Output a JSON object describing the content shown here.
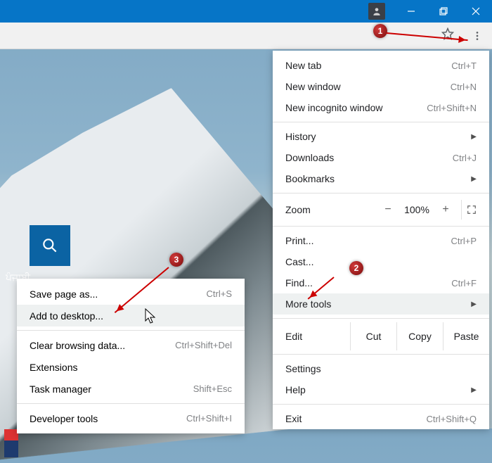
{
  "titlebar": {
    "profile_icon": "person"
  },
  "menu": {
    "new_tab": "New tab",
    "new_tab_sc": "Ctrl+T",
    "new_window": "New window",
    "new_window_sc": "Ctrl+N",
    "new_incognito": "New incognito window",
    "new_incognito_sc": "Ctrl+Shift+N",
    "history": "History",
    "downloads": "Downloads",
    "downloads_sc": "Ctrl+J",
    "bookmarks": "Bookmarks",
    "zoom_label": "Zoom",
    "zoom_value": "100%",
    "print": "Print...",
    "print_sc": "Ctrl+P",
    "cast": "Cast...",
    "find": "Find...",
    "find_sc": "Ctrl+F",
    "more_tools": "More tools",
    "edit": "Edit",
    "cut": "Cut",
    "copy": "Copy",
    "paste": "Paste",
    "settings": "Settings",
    "help": "Help",
    "exit": "Exit",
    "exit_sc": "Ctrl+Shift+Q"
  },
  "submenu": {
    "save_page": "Save page as...",
    "save_page_sc": "Ctrl+S",
    "add_desktop": "Add to desktop...",
    "clear_data": "Clear browsing data...",
    "clear_data_sc": "Ctrl+Shift+Del",
    "extensions": "Extensions",
    "task_manager": "Task manager",
    "task_manager_sc": "Shift+Esc",
    "dev_tools": "Developer tools",
    "dev_tools_sc": "Ctrl+Shift+I"
  },
  "page": {
    "lang": "ਪੰਜਾਬੀ"
  },
  "callouts": {
    "c1": "1",
    "c2": "2",
    "c3": "3"
  }
}
